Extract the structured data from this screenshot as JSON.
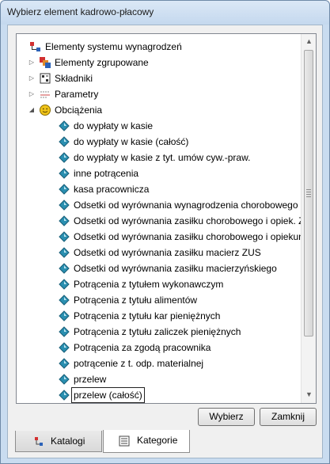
{
  "window": {
    "title": "Wybierz element kadrowo-płacowy"
  },
  "tree": {
    "root": {
      "label": "Elementy systemu wynagrodzeń",
      "icon": "hierarchy-icon"
    },
    "groups": [
      {
        "label": "Elementy zgrupowane",
        "icon": "grouped-elements-icon",
        "expanded": false
      },
      {
        "label": "Składniki",
        "icon": "components-icon",
        "expanded": false
      },
      {
        "label": "Parametry",
        "icon": "parameters-icon",
        "expanded": false
      },
      {
        "label": "Obciążenia",
        "icon": "smiley-coin-icon",
        "expanded": true
      }
    ],
    "items": [
      "do wypłaty w kasie",
      "do wypłaty w kasie (całość)",
      "do wypłaty w kasie z tyt. umów cyw.-praw.",
      "inne potrącenia",
      "kasa pracownicza",
      "Odsetki od wyrównania wynagrodzenia chorobowego",
      "Odsetki od wyrównania zasiłku chorobowego i opiek. ZUS",
      "Odsetki od wyrównania zasiłku chorobowego i opiekuńc",
      "Odsetki od wyrównania zasiłku macierz ZUS",
      "Odsetki od wyrównania zasiłku macierzyńskiego",
      "Potrącenia z tytułem wykonawczym",
      "Potrącenia z tytułu alimentów",
      "Potrącenia z tytułu kar pieniężnych",
      "Potrącenia z tytułu zaliczek pieniężnych",
      "Potrącenia za zgodą pracownika",
      "potrącenie z t. odp. materialnej",
      "przelew",
      "przelew (całość)"
    ],
    "selected_item": "przelew (całość)"
  },
  "buttons": {
    "select": "Wybierz",
    "close": "Zamknij"
  },
  "tabs": [
    {
      "label": "Katalogi",
      "icon": "catalog-icon",
      "active": false
    },
    {
      "label": "Kategorie",
      "icon": "categories-icon",
      "active": true
    }
  ],
  "colors": {
    "frame": "#c9dcf0",
    "item_icon": "#2a8fb0",
    "folder_red": "#d23030"
  }
}
